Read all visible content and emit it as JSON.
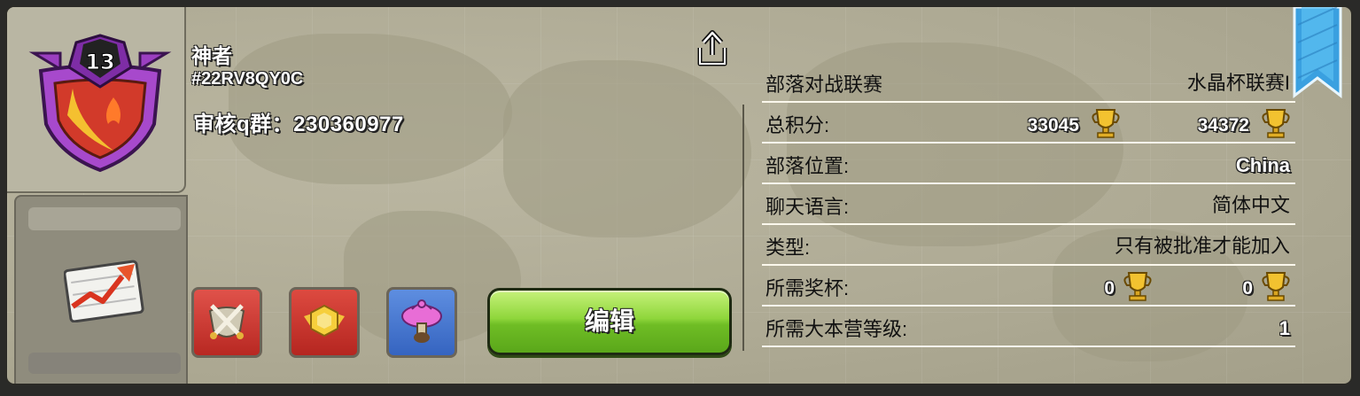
{
  "clan": {
    "level": "13",
    "name": "神者",
    "tag": "#22RV8QY0C",
    "description": "审核q群：230360977"
  },
  "actions": {
    "edit_label": "编辑"
  },
  "perks": [
    {
      "name": "clan-war-perk",
      "color": "#d33a32"
    },
    {
      "name": "clan-games-perk",
      "color": "#c9312a"
    },
    {
      "name": "clan-capital-perk",
      "color": "#3f6fc9"
    }
  ],
  "info": {
    "war_league": {
      "label": "部落对战联赛",
      "value": "水晶杯联赛I"
    },
    "total_points": {
      "label": "总积分:",
      "value1": "33045",
      "value2": "34372"
    },
    "location": {
      "label": "部落位置:",
      "value": "China"
    },
    "chat_language": {
      "label": "聊天语言:",
      "value": "简体中文"
    },
    "type": {
      "label": "类型:",
      "value": "只有被批准才能加入"
    },
    "required_trophies": {
      "label": "所需奖杯:",
      "value1": "0",
      "value2": "0"
    },
    "required_townhall": {
      "label": "所需大本营等级:",
      "value": "1"
    }
  },
  "colors": {
    "panel": "#aeaa94",
    "button_green": "#8fd63b",
    "ribbon_blue": "#3aa0e0"
  },
  "icons": [
    "share-icon",
    "trophy-icon",
    "chart-icon",
    "ribbon-icon"
  ]
}
